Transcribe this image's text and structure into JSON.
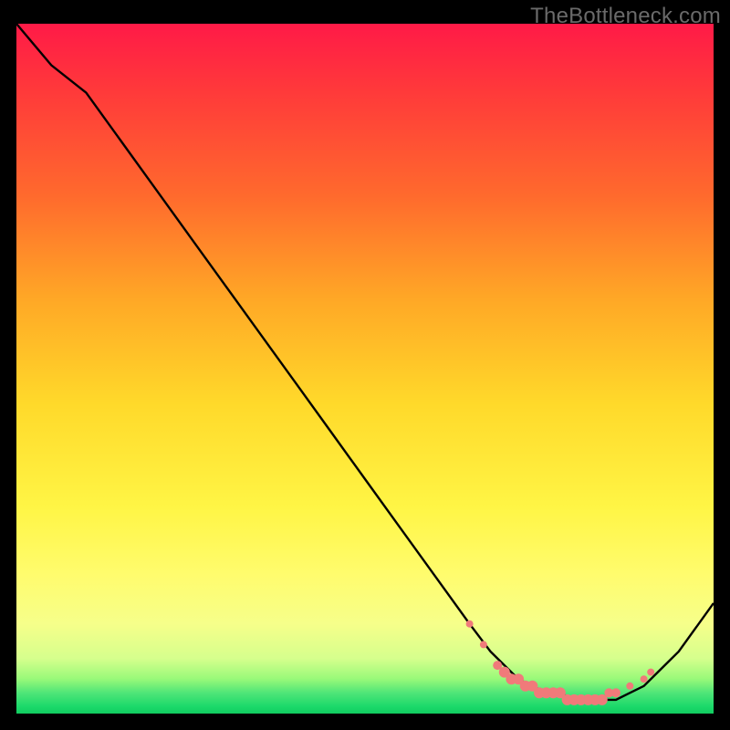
{
  "watermark": "TheBottleneck.com",
  "colors": {
    "line": "#000000",
    "marker_fill": "#f07a7a",
    "marker_stroke": "#d96666",
    "background_black": "#000000"
  },
  "chart_data": {
    "type": "line",
    "title": "",
    "xlabel": "",
    "ylabel": "",
    "xlim": [
      0,
      100
    ],
    "ylim": [
      0,
      100
    ],
    "x": [
      0,
      5,
      10,
      15,
      20,
      25,
      30,
      35,
      40,
      45,
      50,
      55,
      60,
      65,
      68,
      70,
      72,
      74,
      76,
      78,
      80,
      82,
      84,
      86,
      88,
      90,
      92,
      95,
      100
    ],
    "y": [
      100,
      94,
      90,
      83,
      76,
      69,
      62,
      55,
      48,
      41,
      34,
      27,
      20,
      13,
      9,
      7,
      5,
      4,
      3,
      3,
      2,
      2,
      2,
      2,
      3,
      4,
      6,
      9,
      16
    ],
    "markers": [
      {
        "x": 65,
        "y": 13,
        "r": 4
      },
      {
        "x": 67,
        "y": 10,
        "r": 4
      },
      {
        "x": 69,
        "y": 7,
        "r": 5
      },
      {
        "x": 70,
        "y": 6,
        "r": 6
      },
      {
        "x": 71,
        "y": 5,
        "r": 6
      },
      {
        "x": 72,
        "y": 5,
        "r": 6
      },
      {
        "x": 73,
        "y": 4,
        "r": 6
      },
      {
        "x": 74,
        "y": 4,
        "r": 6
      },
      {
        "x": 75,
        "y": 3,
        "r": 6
      },
      {
        "x": 76,
        "y": 3,
        "r": 6
      },
      {
        "x": 77,
        "y": 3,
        "r": 6
      },
      {
        "x": 78,
        "y": 3,
        "r": 6
      },
      {
        "x": 79,
        "y": 2,
        "r": 6
      },
      {
        "x": 80,
        "y": 2,
        "r": 6
      },
      {
        "x": 81,
        "y": 2,
        "r": 6
      },
      {
        "x": 82,
        "y": 2,
        "r": 6
      },
      {
        "x": 83,
        "y": 2,
        "r": 6
      },
      {
        "x": 84,
        "y": 2,
        "r": 6
      },
      {
        "x": 85,
        "y": 3,
        "r": 5
      },
      {
        "x": 86,
        "y": 3,
        "r": 5
      },
      {
        "x": 88,
        "y": 4,
        "r": 4
      },
      {
        "x": 90,
        "y": 5,
        "r": 4
      },
      {
        "x": 91,
        "y": 6,
        "r": 4
      }
    ]
  }
}
